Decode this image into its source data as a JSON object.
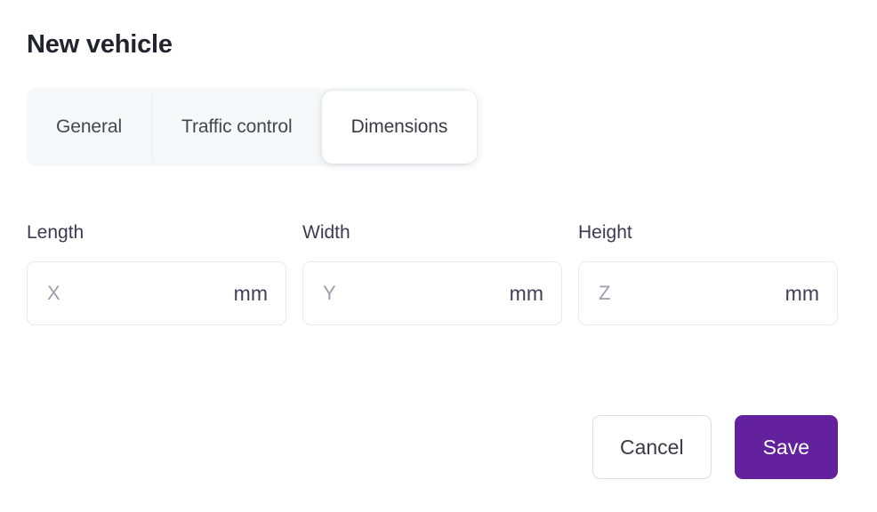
{
  "header": {
    "title": "New vehicle"
  },
  "tabs": {
    "items": [
      {
        "label": "General",
        "active": false
      },
      {
        "label": "Traffic control",
        "active": false
      },
      {
        "label": "Dimensions",
        "active": true
      }
    ]
  },
  "form": {
    "fields": [
      {
        "label": "Length",
        "placeholder": "X",
        "value": "",
        "suffix": "mm"
      },
      {
        "label": "Width",
        "placeholder": "Y",
        "value": "",
        "suffix": "mm"
      },
      {
        "label": "Height",
        "placeholder": "Z",
        "value": "",
        "suffix": "mm"
      }
    ]
  },
  "footer": {
    "cancel_label": "Cancel",
    "save_label": "Save"
  },
  "colors": {
    "accent": "#63219d",
    "title": "#23232e",
    "label": "#3a3a52",
    "tab_inactive_text": "#44474d",
    "tab_bar_bg": "#f7f8fa",
    "input_border": "#e9eaee",
    "placeholder": "#9d9dac",
    "cancel_border": "#dedee7"
  }
}
